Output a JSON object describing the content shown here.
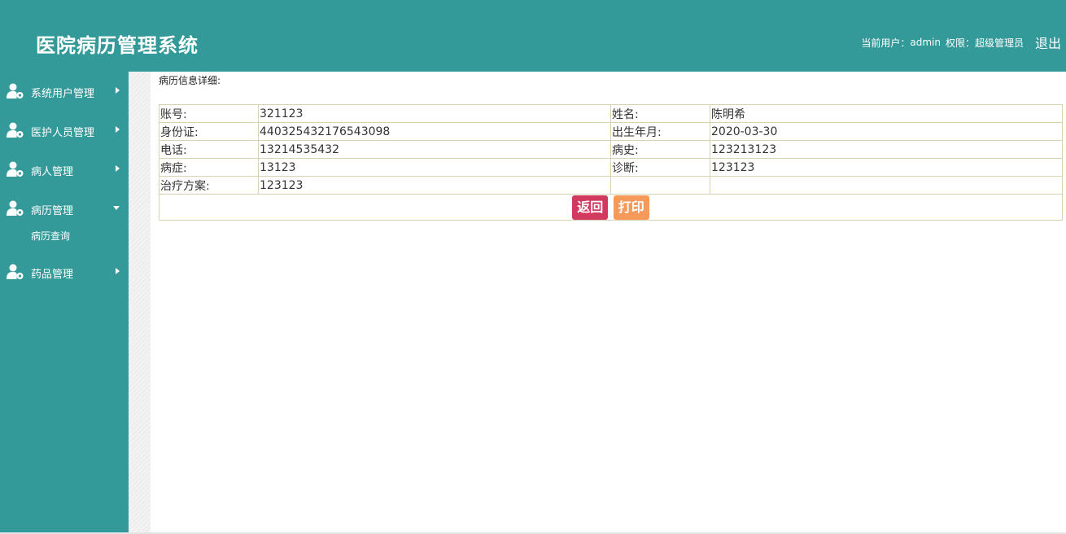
{
  "header": {
    "title": "医院病历管理系统",
    "current_user_label": "当前用户：",
    "username": "admin",
    "role_label": "权限：",
    "role": "超级管理员",
    "logout": "退出"
  },
  "sidebar": {
    "items": [
      {
        "label": "系统用户管理",
        "icon": "user-gear-icon",
        "expanded": false
      },
      {
        "label": "医护人员管理",
        "icon": "user-gear-icon",
        "expanded": false
      },
      {
        "label": "病人管理",
        "icon": "user-gear-icon",
        "expanded": false
      },
      {
        "label": "病历管理",
        "icon": "user-gear-icon",
        "expanded": true,
        "children": [
          {
            "label": "病历查询"
          }
        ]
      },
      {
        "label": "药品管理",
        "icon": "user-gear-icon",
        "expanded": false
      }
    ]
  },
  "main": {
    "section_title": "病历信息详细:",
    "rows": [
      {
        "k1": "账号:",
        "v1": "321123",
        "k2": "姓名:",
        "v2": "陈明希"
      },
      {
        "k1": "身份证:",
        "v1": "440325432176543098",
        "k2": "出生年月:",
        "v2": "2020-03-30"
      },
      {
        "k1": "电话:",
        "v1": "13214535432",
        "k2": "病史:",
        "v2": "123213123"
      },
      {
        "k1": "病症:",
        "v1": "13123",
        "k2": "诊断:",
        "v2": "123123"
      },
      {
        "k1": "治疗方案:",
        "v1": "123123",
        "k2": "",
        "v2": ""
      }
    ],
    "buttons": {
      "back": "返回",
      "print": "打印"
    }
  },
  "colors": {
    "primary": "#339a99",
    "back_button": "#d2395f",
    "print_button": "#f59a5b",
    "table_border": "#d6d3b0"
  }
}
